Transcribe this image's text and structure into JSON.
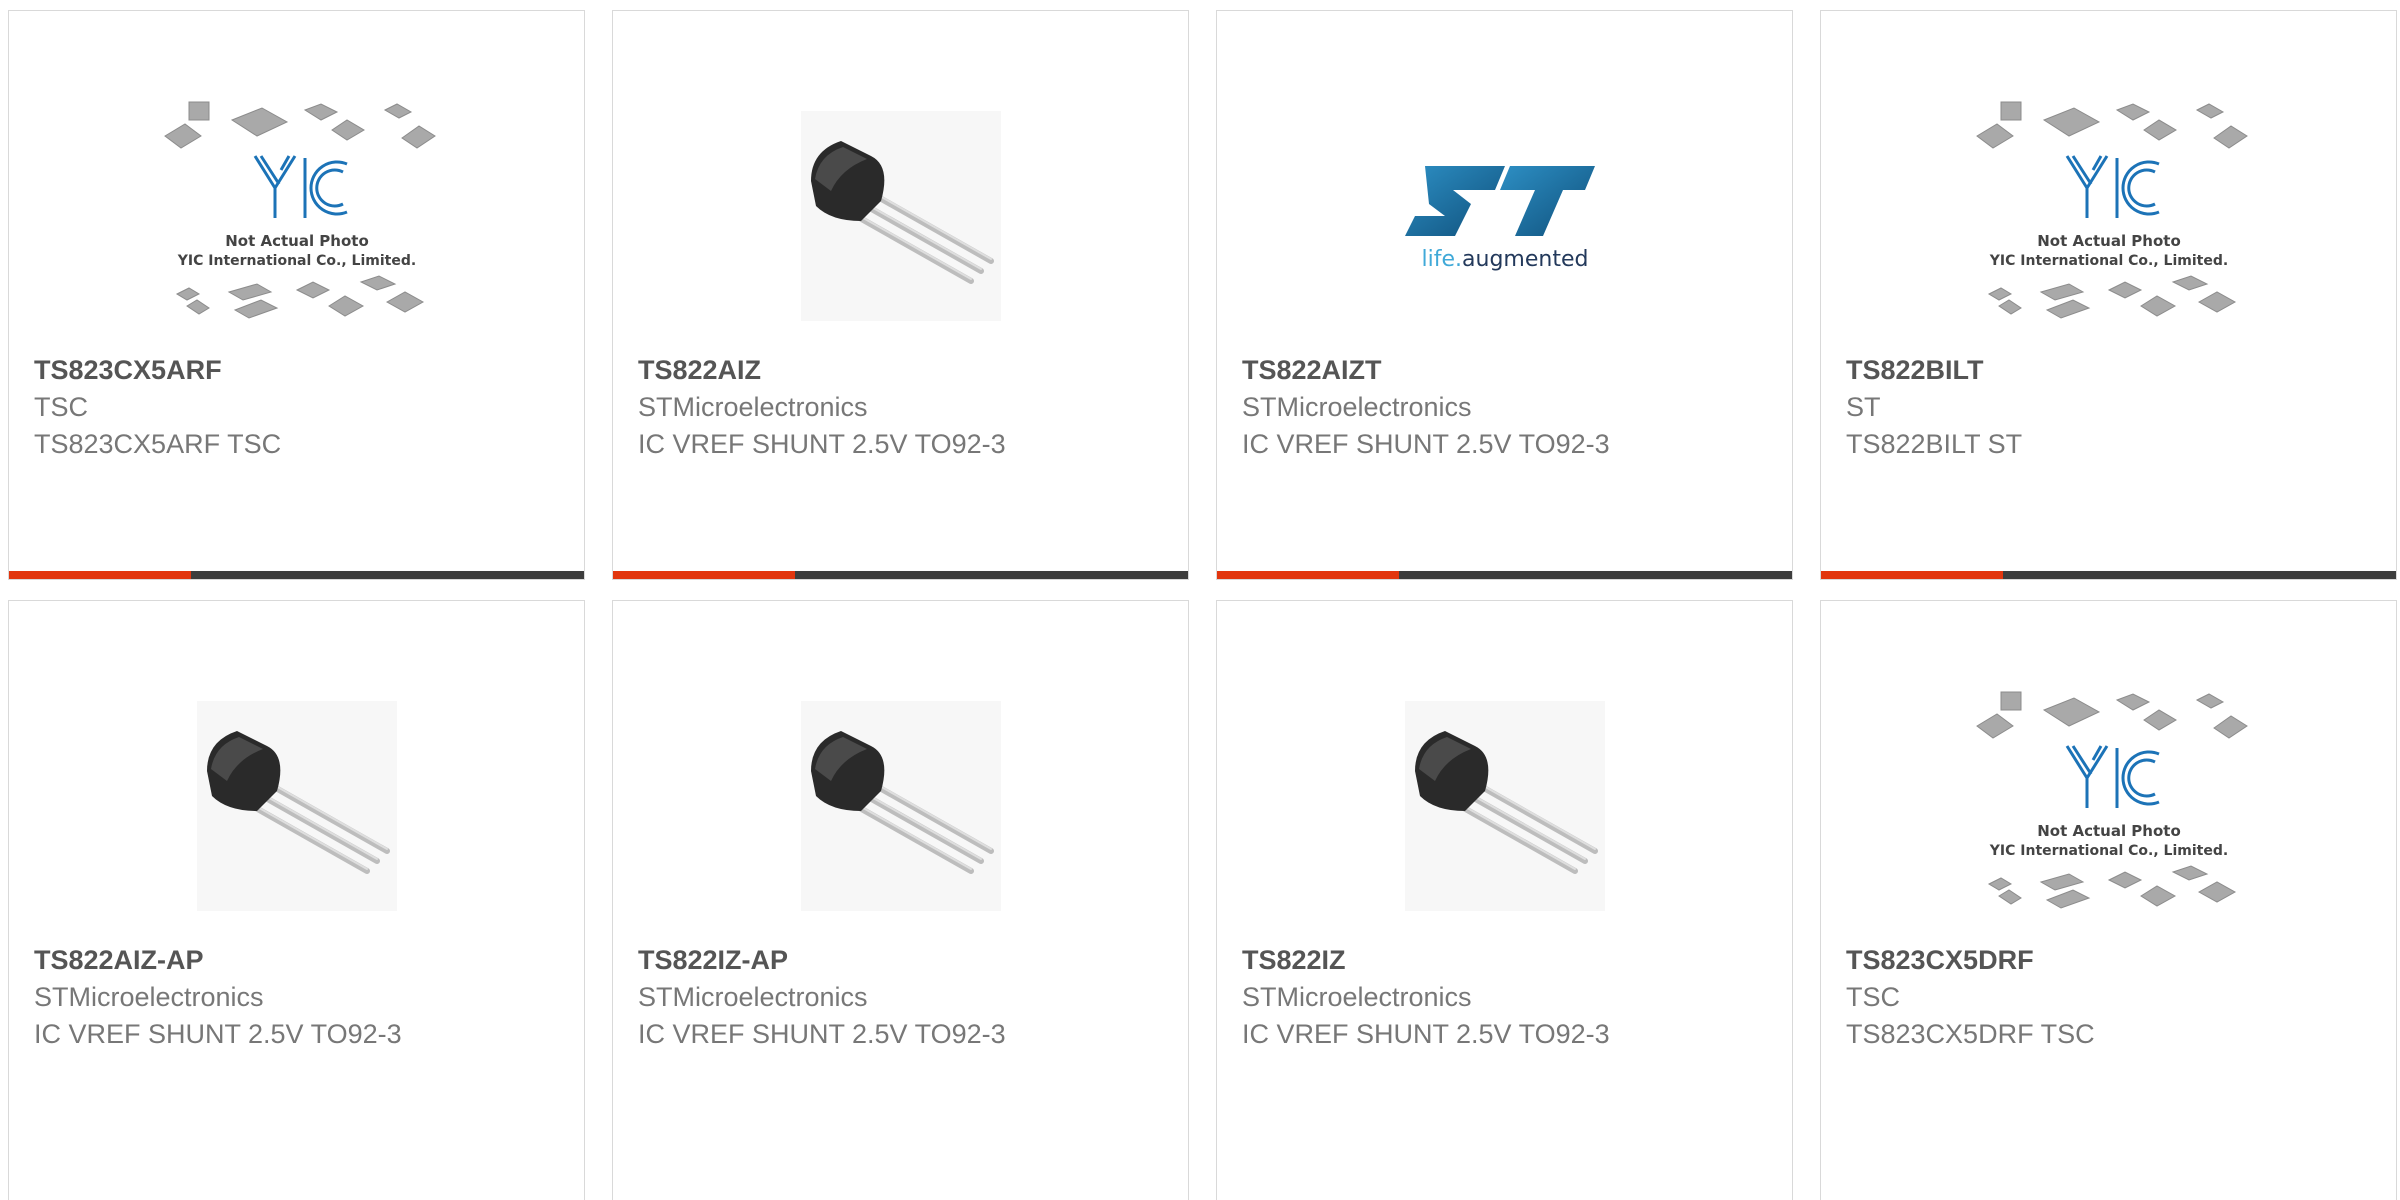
{
  "accent_color": "#e2360e",
  "bar_color": "#3d3d3d",
  "products": [
    {
      "part": "TS823CX5ARF",
      "manufacturer": "TSC",
      "description": "TS823CX5ARF TSC",
      "image": "yic-placeholder-icon"
    },
    {
      "part": "TS822AIZ",
      "manufacturer": "STMicroelectronics",
      "description": "IC VREF SHUNT 2.5V TO92-3",
      "image": "to92-transistor-icon"
    },
    {
      "part": "TS822AIZT",
      "manufacturer": "STMicroelectronics",
      "description": "IC VREF SHUNT 2.5V TO92-3",
      "image": "st-logo-icon"
    },
    {
      "part": "TS822BILT",
      "manufacturer": "ST",
      "description": "TS822BILT ST",
      "image": "yic-placeholder-icon"
    },
    {
      "part": "TS822AIZ-AP",
      "manufacturer": "STMicroelectronics",
      "description": "IC VREF SHUNT 2.5V TO92-3",
      "image": "to92-transistor-icon"
    },
    {
      "part": "TS822IZ-AP",
      "manufacturer": "STMicroelectronics",
      "description": "IC VREF SHUNT 2.5V TO92-3",
      "image": "to92-transistor-icon"
    },
    {
      "part": "TS822IZ",
      "manufacturer": "STMicroelectronics",
      "description": "IC VREF SHUNT 2.5V TO92-3",
      "image": "to92-transistor-icon"
    },
    {
      "part": "TS823CX5DRF",
      "manufacturer": "TSC",
      "description": "TS823CX5DRF TSC",
      "image": "yic-placeholder-icon"
    }
  ],
  "placeholder": {
    "line1": "Not Actual Photo",
    "line2": "YIC International Co., Limited.",
    "logo": "YIC"
  },
  "st_logo": {
    "mark": "ST",
    "tagline_prefix": "life.",
    "tagline_suffix": "augmented"
  }
}
